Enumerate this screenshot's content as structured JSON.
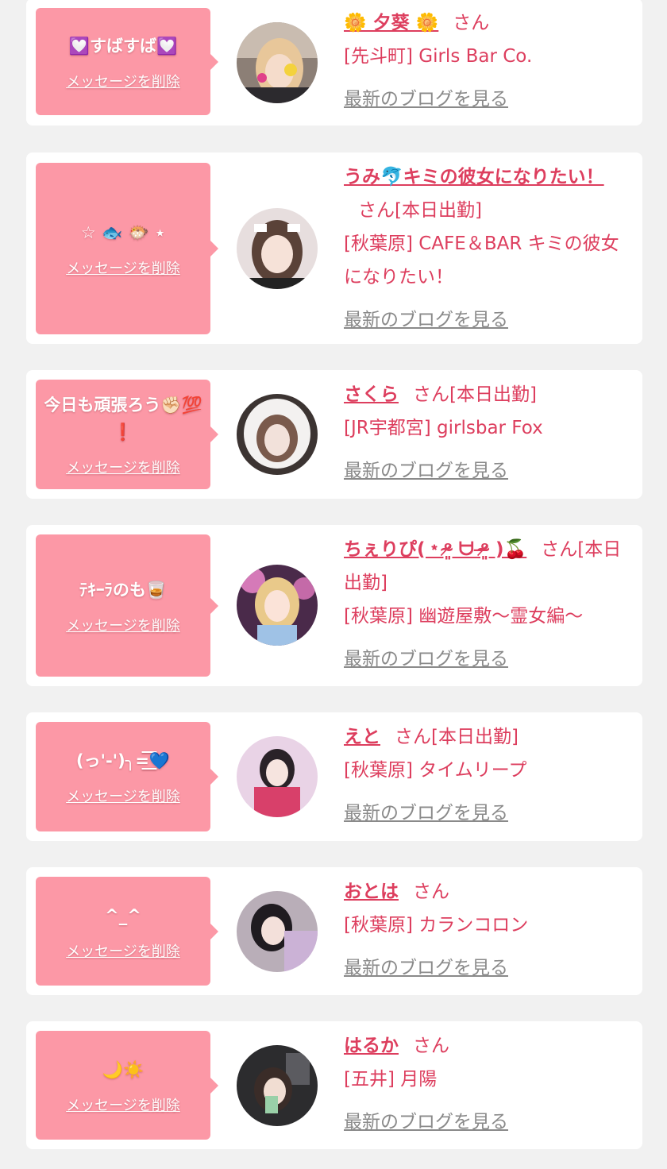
{
  "colors": {
    "background": "#f1f1f1",
    "card": "#ffffff",
    "bubble": "#fc98a6",
    "accent_pink": "#dd3e5e",
    "link_gray": "#8a8a8a"
  },
  "entries": [
    {
      "message": "💟すばすば💟",
      "delete_label": "メッセージを削除",
      "name": "🌼 夕葵 🌼",
      "honorific": "さん",
      "shop": "[先斗町] Girls Bar Co.",
      "blog_link": "最新のブログを見る"
    },
    {
      "message": "☆ 🐟 🐡 ⋆",
      "delete_label": "メッセージを削除",
      "name": "うみ🐬キミの彼女になりたい！",
      "honorific": "さん[本日出勤]",
      "shop": "[秋葉原] CAFE＆BAR キミの彼女になりたい！",
      "blog_link": "最新のブログを見る"
    },
    {
      "message": "今日も頑張ろう✊🏻💯❗️",
      "delete_label": "メッセージを削除",
      "name": "さくら",
      "honorific": "さん[本日出勤]",
      "shop": "[JR宇都宮] girlsbar Fox",
      "blog_link": "最新のブログを見る"
    },
    {
      "message": "ﾃｷｰﾗのも🥃",
      "delete_label": "メッセージを削除",
      "name": "ちぇりぴ(﹡ᵒ̴̷͈ ᗨ ᵒ̴̶̷͈ )🍒",
      "honorific": "さん[本日出勤]",
      "shop": "[秋葉原] 幽遊屋敷～霊女編～",
      "blog_link": "最新のブログを見る"
    },
    {
      "message": "(っ'-')╮=͟͟͞͞💙",
      "delete_label": "メッセージを削除",
      "name": "えと",
      "honorific": "さん[本日出勤]",
      "shop": "[秋葉原] タイムリープ",
      "blog_link": "最新のブログを見る"
    },
    {
      "message": "^_^",
      "delete_label": "メッセージを削除",
      "name": "おとは",
      "honorific": "さん",
      "shop": "[秋葉原] カランコロン",
      "blog_link": "最新のブログを見る"
    },
    {
      "message": "🌙☀️",
      "delete_label": "メッセージを削除",
      "name": "はるか",
      "honorific": "さん",
      "shop": "[五井] 月陽",
      "blog_link": "最新のブログを見る"
    }
  ]
}
